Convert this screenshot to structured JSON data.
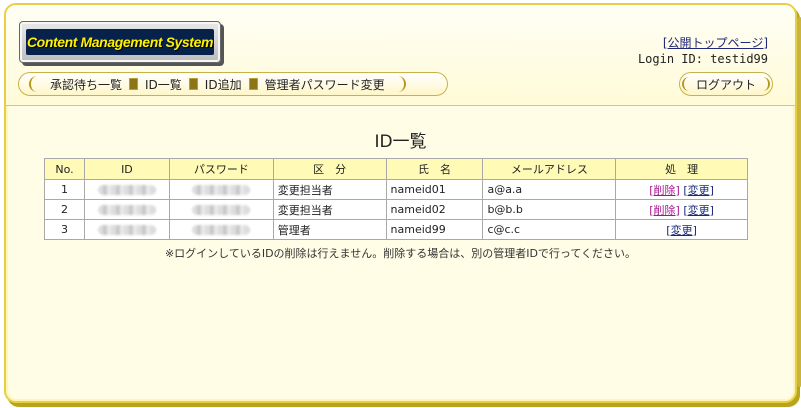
{
  "header": {
    "logo_text": "Content Management System",
    "top_page_link": "[公開トップページ]",
    "login_id": "Login ID: testid99",
    "logout_label": "ログアウト"
  },
  "nav": {
    "items": [
      "承認待ち一覧",
      "ID一覧",
      "ID追加",
      "管理者パスワード変更"
    ]
  },
  "page": {
    "title": "ID一覧",
    "note": "※ログインしているIDの削除は行えません。削除する場合は、別の管理者IDで行ってください。"
  },
  "table": {
    "headers": [
      "No.",
      "ID",
      "パスワード",
      "区　分",
      "氏　名",
      "メールアドレス",
      "処　理"
    ],
    "rows": [
      {
        "no": "1",
        "type": "変更担当者",
        "name": "nameid01",
        "email": "a@a.a",
        "delete": "[削除]",
        "edit": "[変更]"
      },
      {
        "no": "2",
        "type": "変更担当者",
        "name": "nameid02",
        "email": "b@b.b",
        "delete": "[削除]",
        "edit": "[変更]"
      },
      {
        "no": "3",
        "type": "管理者",
        "name": "nameid99",
        "email": "c@c.c",
        "edit": "[変更]"
      }
    ]
  },
  "colors": {
    "frame": "#e7cf45",
    "table_header": "#fffbb6",
    "delete_link": "#a0188a",
    "edit_link": "#1b2a78"
  }
}
